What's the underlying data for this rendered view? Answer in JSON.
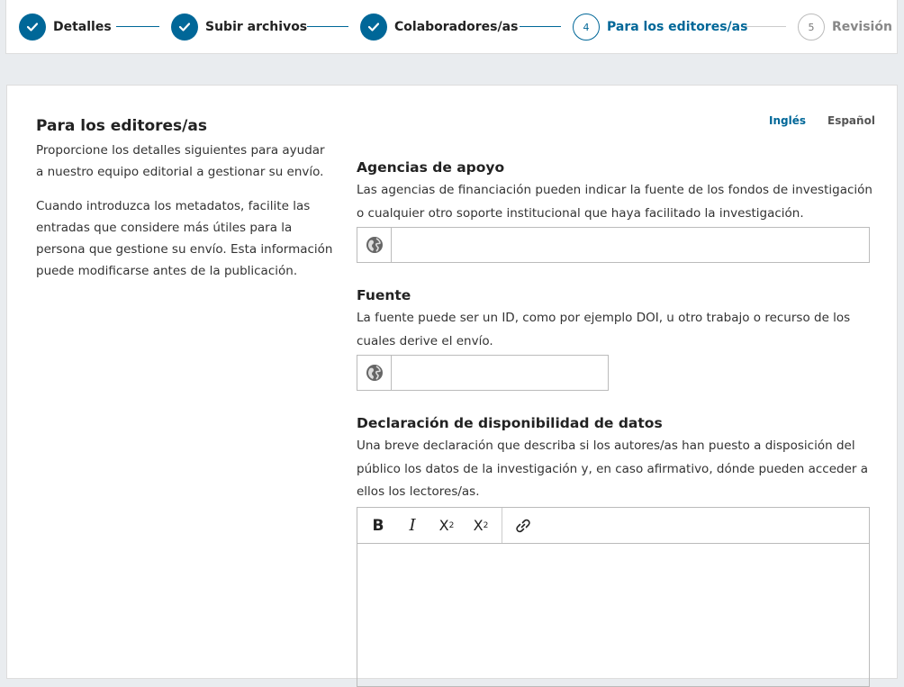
{
  "stepper": {
    "steps": [
      {
        "number": "1",
        "label": "Detalles",
        "state": "done"
      },
      {
        "number": "2",
        "label": "Subir archivos",
        "state": "done"
      },
      {
        "number": "3",
        "label": "Colaboradores/as",
        "state": "done"
      },
      {
        "number": "4",
        "label": "Para los editores/as",
        "state": "current"
      },
      {
        "number": "5",
        "label": "Revisión",
        "state": "todo"
      }
    ],
    "accent": "#006798"
  },
  "sidebar": {
    "title": "Para los editores/as",
    "paragraph1": "Proporcione los detalles siguientes para ayudar a nuestro equipo editorial a gestionar su envío.",
    "paragraph2": "Cuando introduzca los metadatos, facilite las entradas que considere más útiles para la persona que gestione su envío. Esta información puede modificarse antes de la publicación."
  },
  "languages": {
    "items": [
      {
        "label": "Inglés",
        "active": true
      },
      {
        "label": "Español",
        "active": false
      }
    ]
  },
  "fields": {
    "supporting_agencies": {
      "label": "Agencias de apoyo",
      "description": "Las agencias de financiación pueden indicar la fuente de los fondos de investigación o cualquier otro soporte institucional que haya facilitado la investigación.",
      "value": "",
      "icon": "globe-icon"
    },
    "source": {
      "label": "Fuente",
      "description": "La fuente puede ser un ID, como por ejemplo DOI, u otro trabajo o recurso de los cuales derive el envío.",
      "value": "",
      "icon": "globe-icon"
    },
    "data_availability": {
      "label": "Declaración de disponibilidad de datos",
      "description": "Una breve declaración que describa si los autores/as han puesto a disposición del público los datos de la investigación y, en caso afirmativo, dónde pueden acceder a ellos los lectores/as.",
      "value": ""
    }
  },
  "editor_toolbar": {
    "buttons": [
      {
        "name": "bold",
        "glyph": "B"
      },
      {
        "name": "italic",
        "glyph": "I"
      },
      {
        "name": "superscript",
        "glyph": "X",
        "mark": "2"
      },
      {
        "name": "subscript",
        "glyph": "X",
        "mark": "2"
      },
      {
        "name": "link",
        "icon": "link-icon"
      }
    ]
  }
}
